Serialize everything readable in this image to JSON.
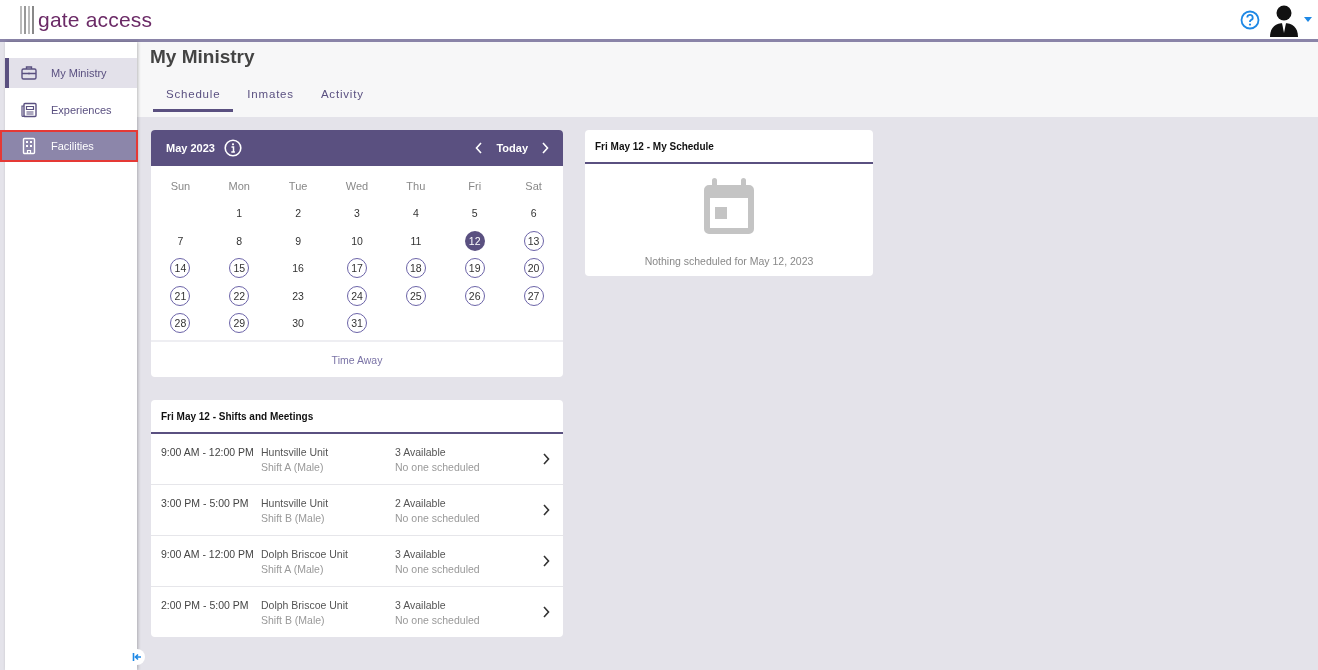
{
  "header": {
    "logo": "gate access"
  },
  "sidebar": {
    "items": [
      {
        "label": "My Ministry",
        "selected": true,
        "highlighted": false
      },
      {
        "label": "Experiences",
        "selected": false,
        "highlighted": false
      },
      {
        "label": "Facilities",
        "selected": false,
        "highlighted": true
      }
    ]
  },
  "page": {
    "title": "My Ministry"
  },
  "tabs": [
    {
      "label": "Schedule",
      "selected": true
    },
    {
      "label": "Inmates",
      "selected": false
    },
    {
      "label": "Activity",
      "selected": false
    }
  ],
  "calendar": {
    "month": "May 2023",
    "today": "Today",
    "weekdays": [
      "Sun",
      "Mon",
      "Tue",
      "Wed",
      "Thu",
      "Fri",
      "Sat"
    ],
    "weeks": [
      [
        {
          "day": "1",
          "circled": false,
          "selected": false
        },
        {
          "day": "2",
          "circled": false,
          "selected": false
        },
        {
          "day": "3",
          "circled": false,
          "selected": false
        },
        {
          "day": "4",
          "circled": false,
          "selected": false
        },
        {
          "day": "5",
          "circled": false,
          "selected": false
        },
        {
          "day": "6",
          "circled": false,
          "selected": false
        }
      ],
      [
        {
          "day": "7",
          "circled": false,
          "selected": false
        },
        {
          "day": "8",
          "circled": false,
          "selected": false
        },
        {
          "day": "9",
          "circled": false,
          "selected": false
        },
        {
          "day": "10",
          "circled": false,
          "selected": false
        },
        {
          "day": "11",
          "circled": false,
          "selected": false
        },
        {
          "day": "12",
          "circled": false,
          "selected": true
        },
        {
          "day": "13",
          "circled": true,
          "selected": false
        }
      ],
      [
        {
          "day": "14",
          "circled": true,
          "selected": false
        },
        {
          "day": "15",
          "circled": true,
          "selected": false
        },
        {
          "day": "16",
          "circled": false,
          "selected": false
        },
        {
          "day": "17",
          "circled": true,
          "selected": false
        },
        {
          "day": "18",
          "circled": true,
          "selected": false
        },
        {
          "day": "19",
          "circled": true,
          "selected": false
        },
        {
          "day": "20",
          "circled": true,
          "selected": false
        }
      ],
      [
        {
          "day": "21",
          "circled": true,
          "selected": false
        },
        {
          "day": "22",
          "circled": true,
          "selected": false
        },
        {
          "day": "23",
          "circled": false,
          "selected": false
        },
        {
          "day": "24",
          "circled": true,
          "selected": false
        },
        {
          "day": "25",
          "circled": true,
          "selected": false
        },
        {
          "day": "26",
          "circled": true,
          "selected": false
        },
        {
          "day": "27",
          "circled": true,
          "selected": false
        }
      ],
      [
        {
          "day": "28",
          "circled": true,
          "selected": false
        },
        {
          "day": "29",
          "circled": true,
          "selected": false
        },
        {
          "day": "30",
          "circled": false,
          "selected": false
        },
        {
          "day": "31",
          "circled": true,
          "selected": false
        }
      ]
    ],
    "footer_link": "Time Away"
  },
  "shifts": {
    "title": "Fri May 12 - Shifts and Meetings",
    "rows": [
      {
        "time": "9:00 AM - 12:00 PM",
        "unit": "Huntsville Unit",
        "shift": "Shift A (Male)",
        "available": "3 Available",
        "scheduled": "No one scheduled"
      },
      {
        "time": "3:00 PM - 5:00 PM",
        "unit": "Huntsville Unit",
        "shift": "Shift B (Male)",
        "available": "2 Available",
        "scheduled": "No one scheduled"
      },
      {
        "time": "9:00 AM - 12:00 PM",
        "unit": "Dolph Briscoe Unit",
        "shift": "Shift A (Male)",
        "available": "3 Available",
        "scheduled": "No one scheduled"
      },
      {
        "time": "2:00 PM - 5:00 PM",
        "unit": "Dolph Briscoe Unit",
        "shift": "Shift B (Male)",
        "available": "3 Available",
        "scheduled": "No one scheduled"
      }
    ]
  },
  "my_schedule": {
    "title": "Fri May 12 - My Schedule",
    "empty_message": "Nothing scheduled for May 12, 2023"
  }
}
